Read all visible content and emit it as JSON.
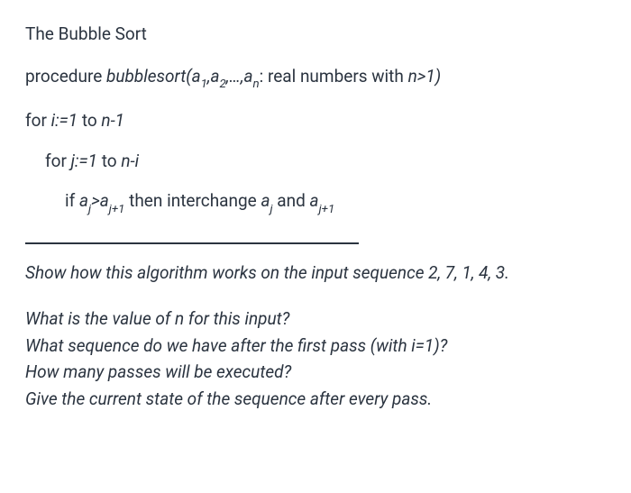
{
  "title": "The Bubble Sort",
  "proc": {
    "pre": "procedure ",
    "name": "bubblesort(a",
    "sub1": "1",
    "comma1": ",a",
    "sub2": "2",
    "mid": ",…,a",
    "subn": "n",
    "post": ": ",
    "post2": "real numbers with ",
    "cond": "n>1)"
  },
  "for_i": {
    "pre": "for ",
    "var": "i:=1",
    "mid": " to ",
    "end": "n-1"
  },
  "for_j": {
    "pre": "for ",
    "var": "j:=1",
    "mid": " to ",
    "end": "n-i"
  },
  "if_line": {
    "pre": "if ",
    "a1": "a",
    "s1": "j",
    "gt": ">a",
    "s2": "j+1",
    "mid": " then interchange ",
    "a2": "a",
    "s3": "j",
    "and": "  and ",
    "a3": "a",
    "s4": "j+1"
  },
  "intro": "Show how this algorithm works on the input sequence 2, 7, 1, 4, 3.",
  "q1": "What is the value of n for this input?",
  "q2": "What sequence do we have after the first pass (with i=1)?",
  "q3": "How many passes will be executed?",
  "q4": "Give the current state of the sequence after every pass."
}
